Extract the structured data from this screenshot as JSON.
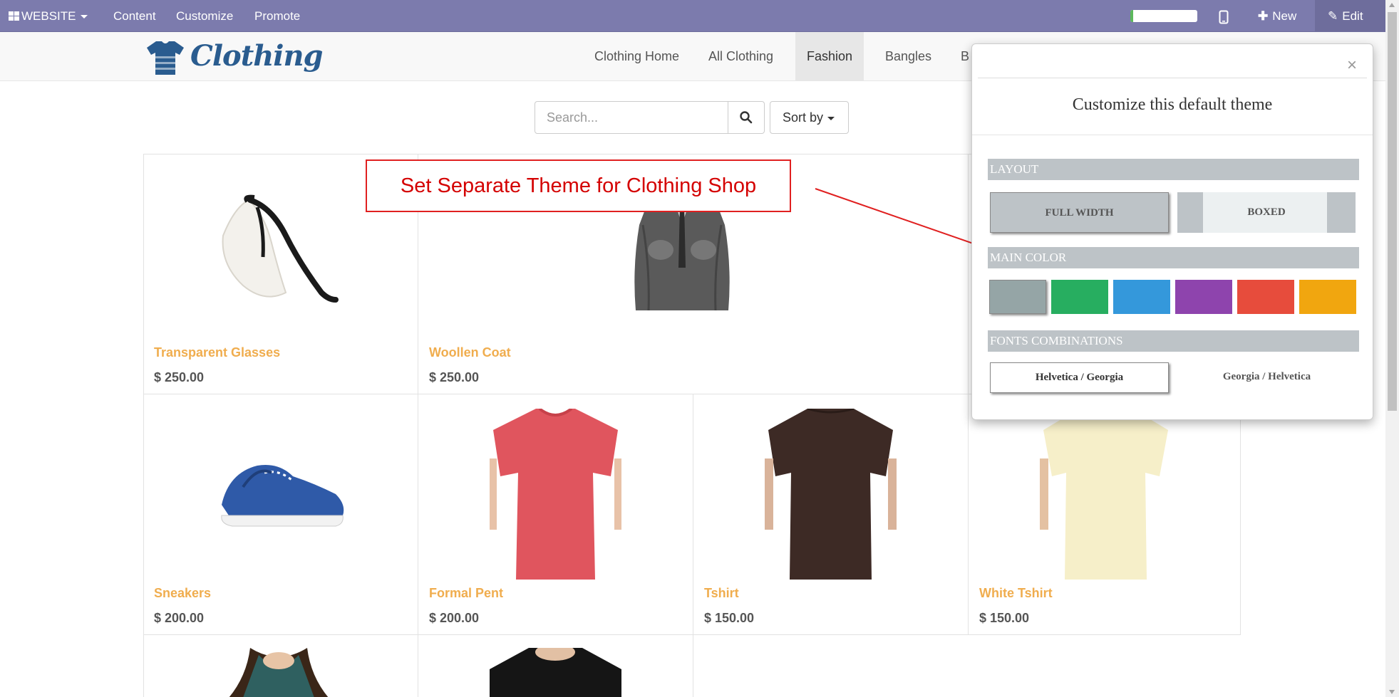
{
  "adminbar": {
    "website_label": "WEBSITE",
    "menu": [
      "Content",
      "Customize",
      "Promote"
    ],
    "new_label": "New",
    "edit_label": "Edit",
    "progress": 0.04,
    "colors": {
      "bar": "#7c7bad"
    }
  },
  "header": {
    "logo_text": "Clothing",
    "nav": [
      "Clothing Home",
      "All Clothing",
      "Fashion",
      "Bangles",
      "B"
    ],
    "active_nav": "Fashion"
  },
  "search": {
    "placeholder": "Search...",
    "sort_label": "Sort by"
  },
  "products": [
    {
      "name": "Transparent Glasses",
      "price": "$ 250.00"
    },
    {
      "name": "Woollen Coat",
      "price": "$ 250.00"
    },
    {
      "name": "Sneakers",
      "price": "$ 200.00"
    },
    {
      "name": "Formal Pent",
      "price": "$ 200.00"
    },
    {
      "name": "Tshirt",
      "price": "$ 150.00"
    },
    {
      "name": "White Tshirt",
      "price": "$ 150.00"
    }
  ],
  "annotation": {
    "text": "Set Separate Theme for Clothing Shop"
  },
  "customize": {
    "close": "×",
    "title": "Customize this default theme",
    "layout_label": "LAYOUT",
    "full_width": "FULL WIDTH",
    "boxed": "BOXED",
    "main_color_label": "MAIN COLOR",
    "colors": [
      "#95a5a6",
      "#27ae60",
      "#3498db",
      "#8e44ad",
      "#e74c3c",
      "#f1a60f"
    ],
    "selected_color": 0,
    "fonts_label": "FONTS COMBINATIONS",
    "font_options": [
      "Helvetica / Georgia",
      "Georgia / Helvetica"
    ]
  },
  "accent": {
    "product_name": "#f0ad4e",
    "callout": "#d40000"
  }
}
